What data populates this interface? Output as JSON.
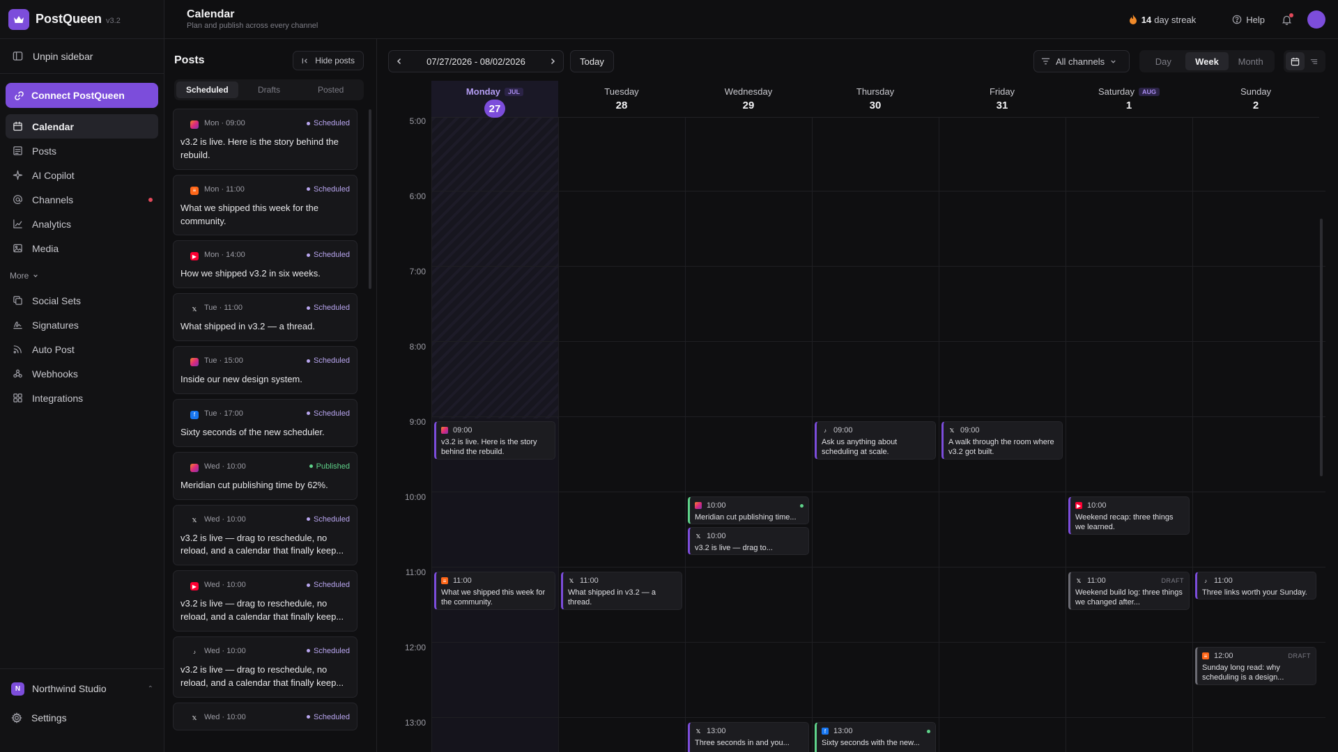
{
  "brand": {
    "name": "PostQueen",
    "version": "v3.2"
  },
  "sidebar": {
    "unpin_label": "Unpin sidebar",
    "connect_label": "Connect PostQueen",
    "items": [
      {
        "label": "Calendar",
        "icon": "calendar-icon",
        "active": true
      },
      {
        "label": "Posts",
        "icon": "posts-icon"
      },
      {
        "label": "AI Copilot",
        "icon": "sparkle-icon"
      },
      {
        "label": "Channels",
        "icon": "at-icon",
        "dot": true
      },
      {
        "label": "Analytics",
        "icon": "chart-icon"
      },
      {
        "label": "Media",
        "icon": "image-icon"
      }
    ],
    "more_label": "More",
    "more_items": [
      {
        "label": "Social Sets",
        "icon": "copy-icon"
      },
      {
        "label": "Signatures",
        "icon": "signature-icon"
      },
      {
        "label": "Auto Post",
        "icon": "rss-icon"
      },
      {
        "label": "Webhooks",
        "icon": "webhook-icon"
      },
      {
        "label": "Integrations",
        "icon": "grid-icon"
      }
    ],
    "workspace": {
      "initial": "N",
      "name": "Northwind Studio"
    },
    "settings_label": "Settings"
  },
  "header": {
    "title": "Calendar",
    "subtitle": "Plan and publish across every channel",
    "streak_count": "14",
    "streak_label": "day streak",
    "help_label": "Help"
  },
  "posts_panel": {
    "title": "Posts",
    "hide_label": "Hide posts",
    "tabs": [
      "Scheduled",
      "Drafts",
      "Posted"
    ],
    "active_tab": "Scheduled",
    "items": [
      {
        "platform": "instagram",
        "time": "Mon · 09:00",
        "status": "Scheduled",
        "text": "v3.2 is live. Here is the story behind the rebuild."
      },
      {
        "platform": "substack",
        "time": "Mon · 11:00",
        "status": "Scheduled",
        "text": "What we shipped this week for the community."
      },
      {
        "platform": "youtube",
        "time": "Mon · 14:00",
        "status": "Scheduled",
        "text": "How we shipped v3.2 in six weeks."
      },
      {
        "platform": "x",
        "time": "Tue · 11:00",
        "status": "Scheduled",
        "text": "What shipped in v3.2 — a thread."
      },
      {
        "platform": "instagram",
        "time": "Tue · 15:00",
        "status": "Scheduled",
        "text": "Inside our new design system."
      },
      {
        "platform": "facebook",
        "time": "Tue · 17:00",
        "status": "Scheduled",
        "text": "Sixty seconds of the new scheduler."
      },
      {
        "platform": "instagram",
        "time": "Wed · 10:00",
        "status": "Published",
        "text": "Meridian cut publishing time by 62%."
      },
      {
        "platform": "x",
        "time": "Wed · 10:00",
        "status": "Scheduled",
        "text": "v3.2 is live — drag to reschedule, no reload, and a calendar that finally keep..."
      },
      {
        "platform": "youtube",
        "time": "Wed · 10:00",
        "status": "Scheduled",
        "text": "v3.2 is live — drag to reschedule, no reload, and a calendar that finally keep..."
      },
      {
        "platform": "tiktok",
        "time": "Wed · 10:00",
        "status": "Scheduled",
        "text": "v3.2 is live — drag to reschedule, no reload, and a calendar that finally keep..."
      },
      {
        "platform": "x",
        "time": "Wed · 10:00",
        "status": "Scheduled",
        "text": ""
      }
    ]
  },
  "calendar": {
    "date_range": "07/27/2026 - 08/02/2026",
    "today_label": "Today",
    "channels_label": "All channels",
    "views": [
      "Day",
      "Week",
      "Month"
    ],
    "active_view": "Week",
    "days": [
      {
        "name": "Monday",
        "num": "27",
        "month_tag": "JUL",
        "today": true
      },
      {
        "name": "Tuesday",
        "num": "28"
      },
      {
        "name": "Wednesday",
        "num": "29"
      },
      {
        "name": "Thursday",
        "num": "30"
      },
      {
        "name": "Friday",
        "num": "31"
      },
      {
        "name": "Saturday",
        "num": "1",
        "month_tag": "AUG"
      },
      {
        "name": "Sunday",
        "num": "2"
      }
    ],
    "hours": [
      "5:00",
      "6:00",
      "7:00",
      "8:00",
      "9:00",
      "10:00",
      "11:00",
      "12:00",
      "13:00"
    ],
    "events": [
      {
        "day": 0,
        "hour": 9,
        "offset": 0,
        "platform": "instagram",
        "time": "09:00",
        "text": "v3.2 is live. Here is the story behind the rebuild."
      },
      {
        "day": 3,
        "hour": 9,
        "offset": 0,
        "platform": "tiktok",
        "time": "09:00",
        "text": "Ask us anything about scheduling at scale."
      },
      {
        "day": 4,
        "hour": 9,
        "offset": 0,
        "platform": "x",
        "time": "09:00",
        "text": "A walk through the room where v3.2 got built."
      },
      {
        "day": 2,
        "hour": 10,
        "offset": 0,
        "platform": "instagram",
        "time": "10:00",
        "text": "Meridian cut publishing time...",
        "kind": "pub",
        "single": true
      },
      {
        "day": 2,
        "hour": 10,
        "offset": 1,
        "platform": "x",
        "time": "10:00",
        "text": "v3.2 is live — drag to...",
        "single": true
      },
      {
        "day": 5,
        "hour": 10,
        "offset": 0,
        "platform": "youtube",
        "time": "10:00",
        "text": "Weekend recap: three things we learned."
      },
      {
        "day": 0,
        "hour": 11,
        "offset": 0,
        "platform": "substack",
        "time": "11:00",
        "text": "What we shipped this week for the community."
      },
      {
        "day": 1,
        "hour": 11,
        "offset": 0,
        "platform": "x",
        "time": "11:00",
        "text": "What shipped in v3.2 — a thread."
      },
      {
        "day": 5,
        "hour": 11,
        "offset": 0,
        "platform": "x",
        "time": "11:00",
        "text": "Weekend build log: three things we changed after...",
        "kind": "draft",
        "tag": "DRAFT"
      },
      {
        "day": 6,
        "hour": 11,
        "offset": 0,
        "platform": "tiktok",
        "time": "11:00",
        "text": "Three links worth your Sunday.",
        "single": true
      },
      {
        "day": 6,
        "hour": 12,
        "offset": 0,
        "platform": "substack",
        "time": "12:00",
        "text": "Sunday long read: why scheduling is a design...",
        "kind": "draft",
        "tag": "DRAFT"
      },
      {
        "day": 2,
        "hour": 13,
        "offset": 0,
        "platform": "x",
        "time": "13:00",
        "text": "Three seconds in and you..."
      },
      {
        "day": 3,
        "hour": 13,
        "offset": 0,
        "platform": "facebook",
        "time": "13:00",
        "text": "Sixty seconds with the new...",
        "kind": "pub"
      }
    ]
  },
  "colors": {
    "accent": "#7c4ddb",
    "published": "#5fd38a",
    "alert": "#e2495a"
  }
}
